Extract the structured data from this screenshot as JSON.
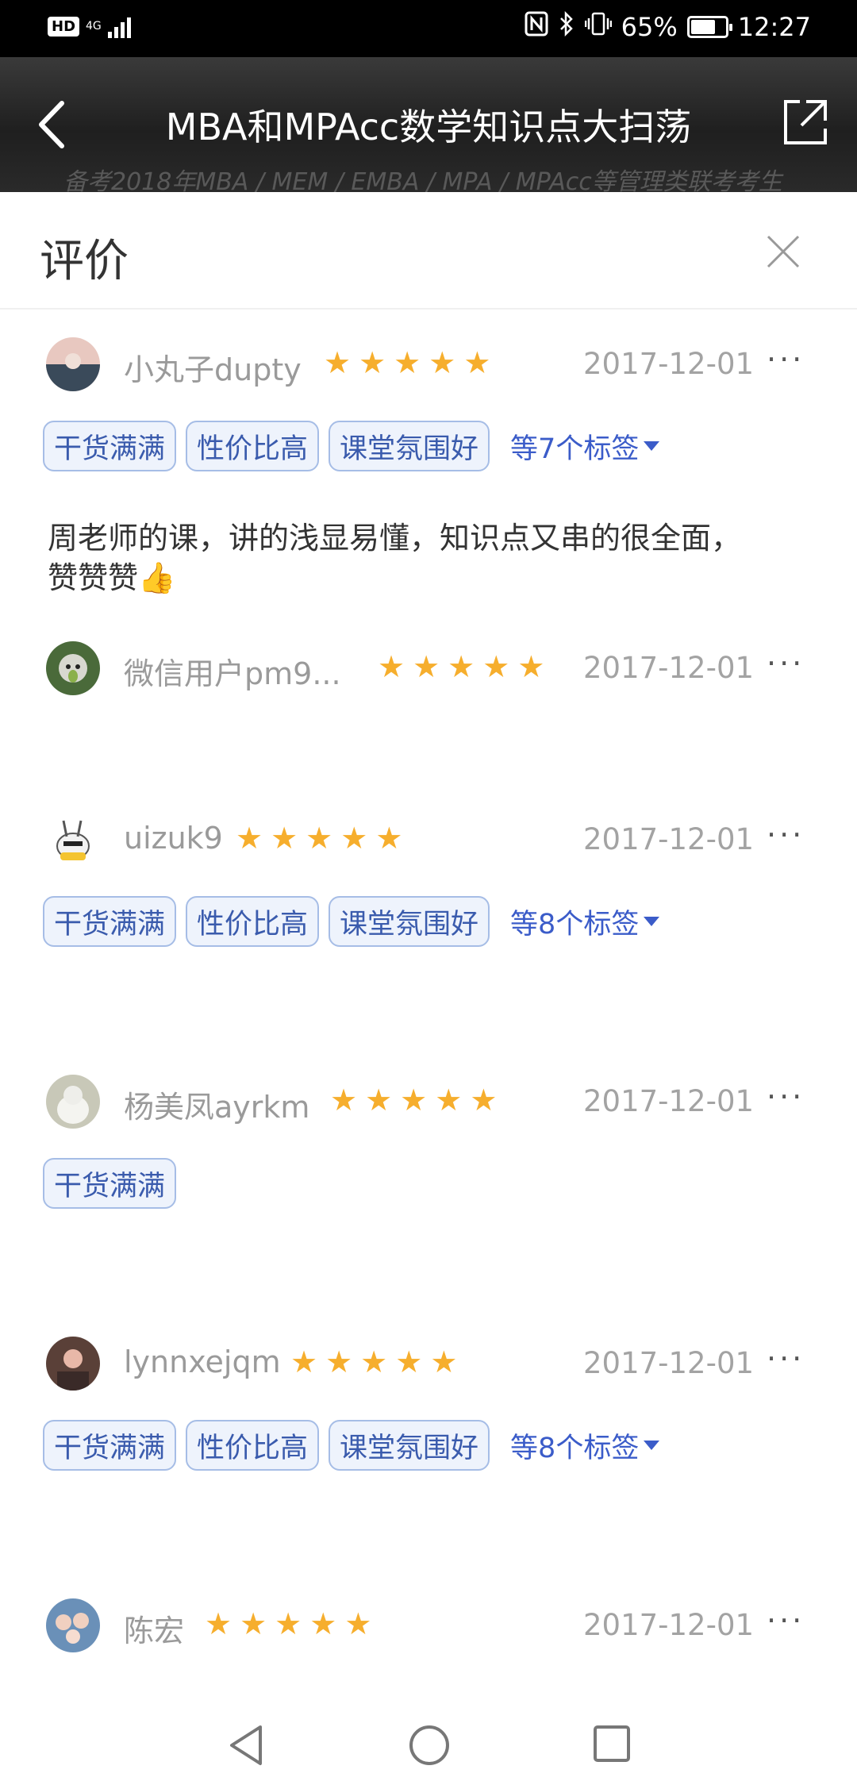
{
  "status_bar": {
    "hd": "HD",
    "network": "4G",
    "battery_percent": "65%",
    "time": "12:27"
  },
  "header": {
    "title": "MBA和MPAcc数学知识点大扫荡",
    "background_text": "备考2018年MBA / MEM / EMBA / MPA / MPAcc等管理类联考考生"
  },
  "sheet": {
    "title": "评价"
  },
  "reviews": [
    {
      "username": "小丸子dupty",
      "stars": 5,
      "date": "2017-12-01",
      "more": "···",
      "tags": [
        "干货满满",
        "性价比高",
        "课堂氛围好"
      ],
      "tags_more": "等7个标签",
      "comment": "周老师的课，讲的浅显易懂，知识点又串的很全面，赞赞赞👍"
    },
    {
      "username": "微信用户pm9...",
      "stars": 5,
      "date": "2017-12-01",
      "more": "···",
      "tags": [],
      "tags_more": "",
      "comment": ""
    },
    {
      "username": "uizuk9",
      "stars": 5,
      "date": "2017-12-01",
      "more": "···",
      "tags": [
        "干货满满",
        "性价比高",
        "课堂氛围好"
      ],
      "tags_more": "等8个标签",
      "comment": ""
    },
    {
      "username": "杨美凤ayrkm",
      "stars": 5,
      "date": "2017-12-01",
      "more": "···",
      "tags": [
        "干货满满"
      ],
      "tags_more": "",
      "comment": ""
    },
    {
      "username": "lynnxejqm",
      "stars": 5,
      "date": "2017-12-01",
      "more": "···",
      "tags": [
        "干货满满",
        "性价比高",
        "课堂氛围好"
      ],
      "tags_more": "等8个标签",
      "comment": ""
    },
    {
      "username": "陈宏",
      "stars": 5,
      "date": "2017-12-01",
      "more": "···",
      "tags": [],
      "tags_more": "",
      "comment": ""
    }
  ],
  "colors": {
    "star": "#f6ae2d",
    "tag_border": "#a6bde6",
    "tag_text": "#3a5bad",
    "link_blue": "#3b5cc9"
  }
}
